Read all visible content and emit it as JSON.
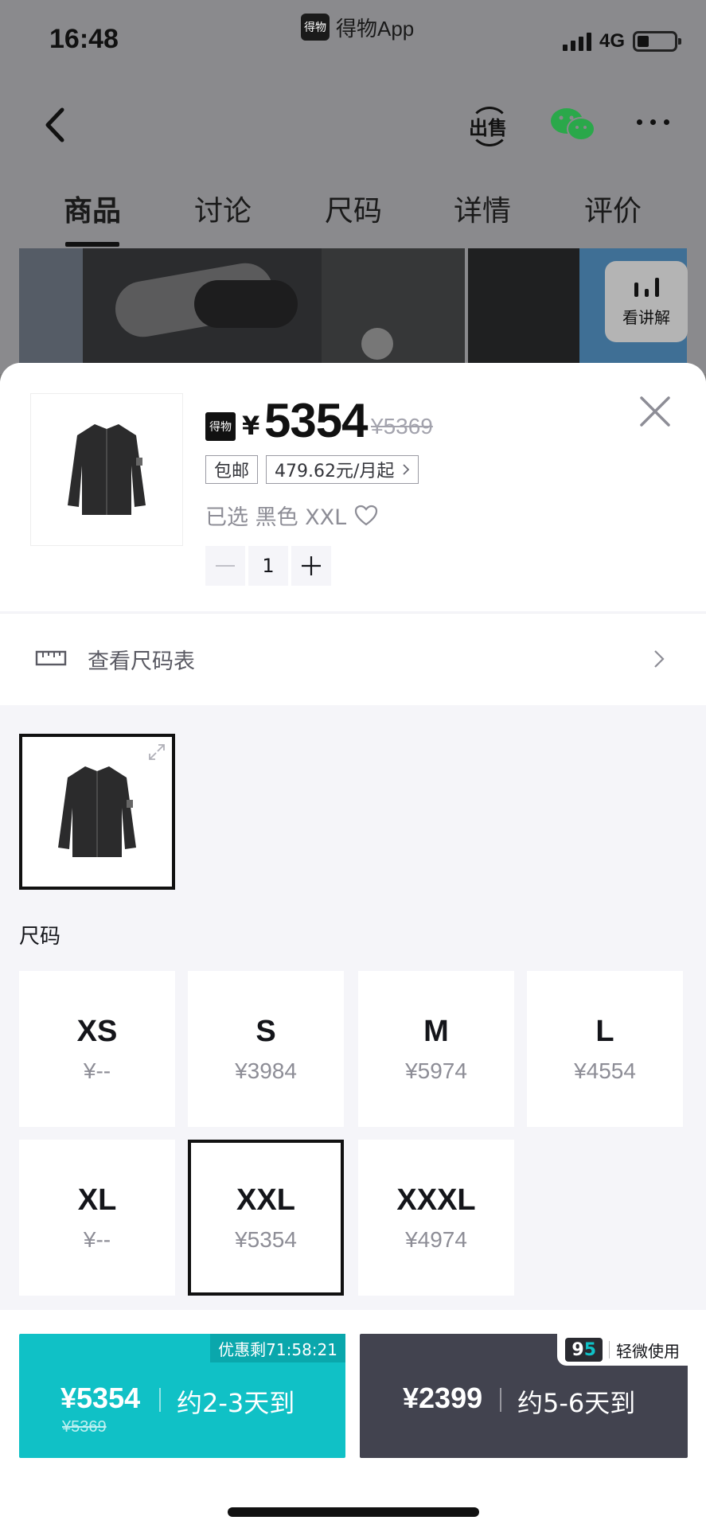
{
  "status_bar": {
    "time": "16:48",
    "app_name": "得物App",
    "app_logo_text": "得物",
    "network": "4G"
  },
  "nav": {
    "sell_label": "出售"
  },
  "tabs": [
    {
      "label": "商品",
      "active": true
    },
    {
      "label": "讨论",
      "active": false
    },
    {
      "label": "尺码",
      "active": false
    },
    {
      "label": "详情",
      "active": false
    },
    {
      "label": "评价",
      "active": false
    }
  ],
  "explain_button": {
    "label": "看讲解"
  },
  "sheet": {
    "logo_text": "得物",
    "currency": "¥",
    "price": "5354",
    "original_price": "¥5369",
    "chip_shipping": "包邮",
    "chip_installment": "479.62元/月起",
    "selected_text": "已选 黑色 XXL",
    "quantity": "1",
    "size_chart_label": "查看尺码表",
    "size_section_title": "尺码",
    "sizes": [
      {
        "name": "XS",
        "price": "¥--",
        "selected": false
      },
      {
        "name": "S",
        "price": "¥3984",
        "selected": false
      },
      {
        "name": "M",
        "price": "¥5974",
        "selected": false
      },
      {
        "name": "L",
        "price": "¥4554",
        "selected": false
      },
      {
        "name": "XL",
        "price": "¥--",
        "selected": false
      },
      {
        "name": "XXL",
        "price": "¥5354",
        "selected": true
      },
      {
        "name": "XXXL",
        "price": "¥4974",
        "selected": false
      }
    ]
  },
  "bottom": {
    "fast": {
      "promo": "优惠剩71:58:21",
      "price": "¥5354",
      "original_price": "¥5369",
      "eta": "约2-3天到"
    },
    "used": {
      "badge_9": "9",
      "badge_5": "5",
      "label": "轻微使用",
      "price": "¥2399",
      "eta": "约5-6天到"
    }
  },
  "colors": {
    "accent_teal": "#10c1c6",
    "used_dark": "#42434f",
    "text_primary": "#14151a",
    "text_secondary": "#8d8d96"
  }
}
